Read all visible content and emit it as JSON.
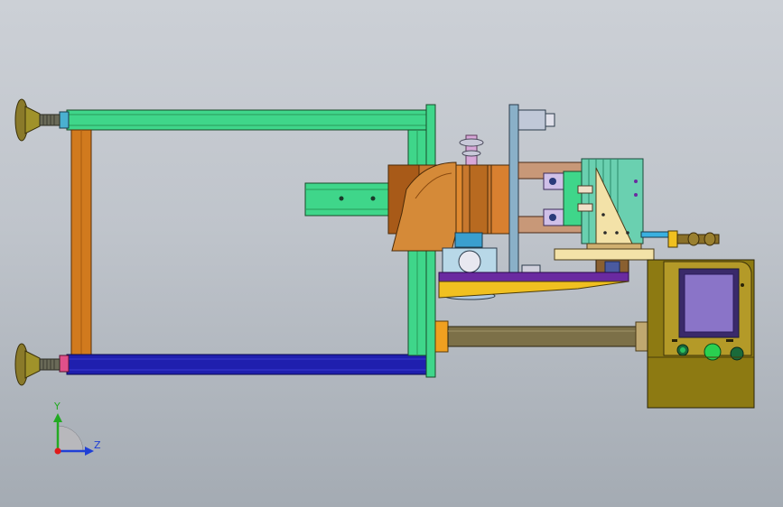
{
  "triad": {
    "y_label": "Y",
    "z_label": "Z",
    "colors": {
      "y_axis": "#22aa22",
      "z_axis": "#1f3fd6",
      "origin": "#e01a1a"
    }
  },
  "colors": {
    "background": "#c4c9cf",
    "frame_green": "#3fd68a",
    "frame_blue": "#1f1fae",
    "frame_orange": "#d17a1e",
    "leveling_foot": "#7a6a22",
    "control_box": "#8d7a12",
    "hmi_screen": "#8a74c8",
    "button_green": "#22aa44",
    "rod_olive": "#7c7048",
    "bracket_yellow": "#f0c020",
    "plate_purple": "#6a2aa0"
  },
  "icons": [
    "leveling-foot-icon",
    "control-panel-icon",
    "coordinate-triad-icon"
  ]
}
